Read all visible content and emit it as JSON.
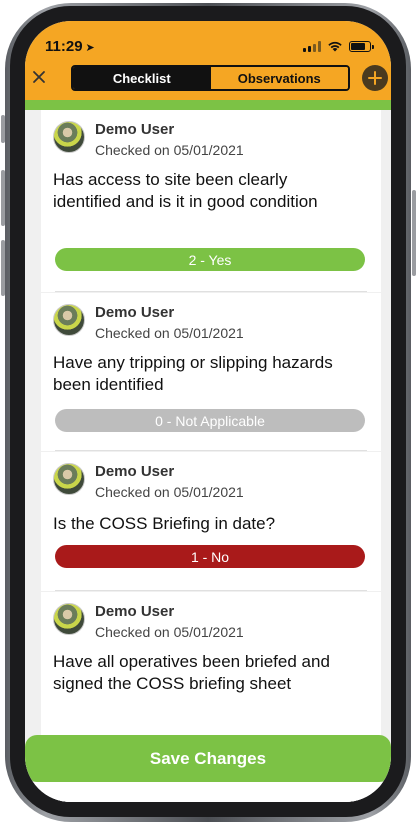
{
  "status_bar": {
    "time": "11:29"
  },
  "header": {
    "tabs": [
      {
        "label": "Checklist",
        "active": true
      },
      {
        "label": "Observations",
        "active": false
      }
    ]
  },
  "colors": {
    "header_orange": "#f5a623",
    "accent_green": "#7cc245",
    "answer_yes": "#7cc245",
    "answer_na": "#bdbdbd",
    "answer_no": "#a91a1a"
  },
  "icons": {
    "close": "close-icon",
    "add": "plus-icon",
    "location": "location-arrow-icon"
  },
  "items": [
    {
      "user": "Demo User",
      "checked": "Checked on 05/01/2021",
      "question": "Has access to site been clearly identified and is it in good condition",
      "answer": "2 - Yes",
      "answer_color": "#7cc245"
    },
    {
      "user": "Demo User",
      "checked": "Checked on 05/01/2021",
      "question": "Have any tripping or slipping hazards been identified",
      "answer": "0 - Not Applicable",
      "answer_color": "#bdbdbd"
    },
    {
      "user": "Demo User",
      "checked": "Checked on 05/01/2021",
      "question": "Is the COSS Briefing in date?",
      "answer": "1 - No",
      "answer_color": "#a91a1a"
    },
    {
      "user": "Demo User",
      "checked": "Checked on 05/01/2021",
      "question": "Have all operatives been briefed and signed the COSS briefing sheet",
      "answer": "",
      "answer_color": ""
    }
  ],
  "footer": {
    "save_label": "Save Changes"
  }
}
